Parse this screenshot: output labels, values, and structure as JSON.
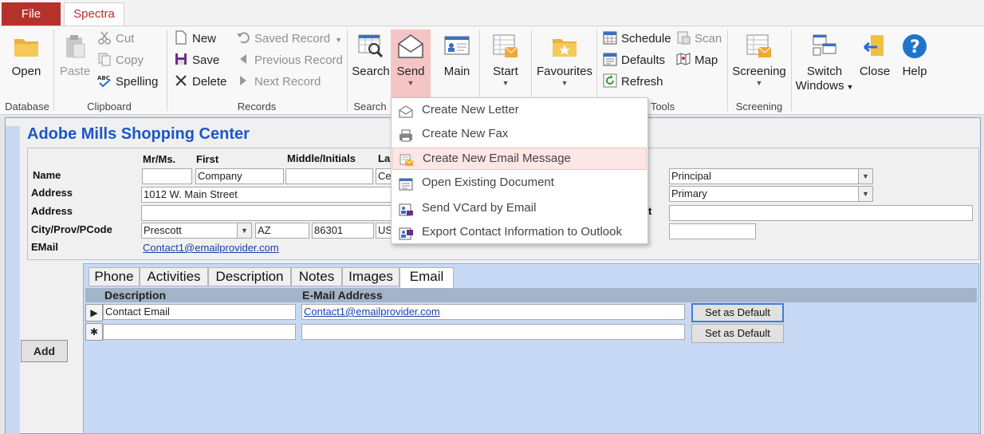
{
  "tabs": {
    "file": "File",
    "spectra": "Spectra"
  },
  "ribbon": {
    "groups": {
      "database": "Database",
      "clipboard": "Clipboard",
      "records": "Records",
      "search": "Search",
      "tools": "Tools",
      "screening": "Screening"
    },
    "open": "Open",
    "paste": "Paste",
    "cut": "Cut",
    "copy": "Copy",
    "spelling": "Spelling",
    "new": "New",
    "save": "Save",
    "delete": "Delete",
    "saved_record": "Saved Record",
    "previous_record": "Previous Record",
    "next_record": "Next Record",
    "search": "Search",
    "send": "Send",
    "main": "Main",
    "start": "Start",
    "favourites": "Favourites",
    "schedule": "Schedule",
    "defaults": "Defaults",
    "refresh": "Refresh",
    "scan": "Scan",
    "map": "Map",
    "screening": "Screening",
    "switch_windows_1": "Switch",
    "switch_windows_2": "Windows",
    "close": "Close",
    "help": "Help",
    "abc": "ABC"
  },
  "send_menu": {
    "items": [
      "Create New Letter",
      "Create New Fax",
      "Create New Email Message",
      "Open Existing Document",
      "Send VCard by Email",
      "Export Contact Information to Outlook"
    ]
  },
  "form": {
    "title": "Adobe Mills Shopping Center",
    "headers": {
      "mrms": "Mr/Ms.",
      "first": "First",
      "middle": "Middle/Initials",
      "last_partial": "La"
    },
    "labels": {
      "name": "Name",
      "address": "Address",
      "address2": "Address",
      "city": "City/Prov/PCode",
      "email": "EMail",
      "contact_partial": "t"
    },
    "values": {
      "mrms": "",
      "first": "Company",
      "middle": "",
      "last_partial": "Ce",
      "address1": "1012 W. Main Street",
      "address2": "",
      "city": "Prescott",
      "state": "AZ",
      "postcode": "86301",
      "country_partial": "US",
      "email": "Contact1@emailprovider.com",
      "role": "Principal",
      "addr_type": "Primary",
      "right_field3": "",
      "right_field4": ""
    }
  },
  "subform": {
    "tabs": [
      "Phone",
      "Activities",
      "Description",
      "Notes",
      "Images",
      "Email"
    ],
    "columns": {
      "description": "Description",
      "email": "E-Mail Address"
    },
    "rows": [
      {
        "description": "Contact Email",
        "email": "Contact1@emailprovider.com",
        "button": "Set as Default"
      },
      {
        "description": "",
        "email": "",
        "button": "Set as Default"
      }
    ],
    "selector_current": "▶",
    "selector_new": "✱"
  },
  "add_button": "Add",
  "colors": {
    "file_tab": "#b7312c",
    "title": "#1c56c9",
    "subform_bg": "#c7d9f5",
    "send_highlight": "#f5c4c4"
  }
}
